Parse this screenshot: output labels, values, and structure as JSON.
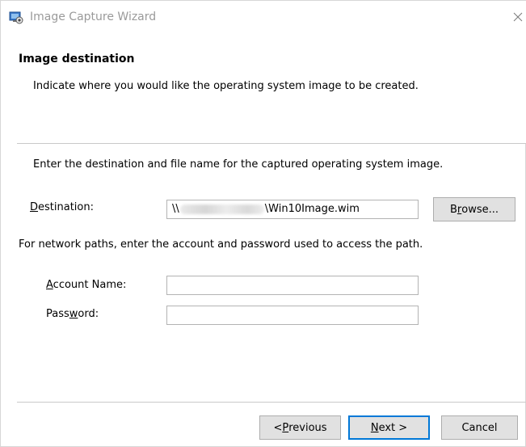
{
  "window": {
    "title": "Image Capture Wizard",
    "icon": "capture-wizard-icon",
    "close_icon": "close-icon"
  },
  "header": {
    "title": "Image destination",
    "description": "Indicate where you would like the operating system image to be created."
  },
  "body": {
    "instruction": "Enter the destination and file name for the captured operating system image.",
    "destination": {
      "label_access_key": "D",
      "label_rest": "estination:",
      "value_prefix": "\\\\",
      "value_suffix": "\\Win10Image.wim"
    },
    "browse": {
      "label_pre": "B",
      "label_access_key": "r",
      "label_post": "owse..."
    },
    "network_note": "For network paths, enter the account and password used to access the path.",
    "account_name": {
      "label_access_key": "A",
      "label_rest": "ccount Name:",
      "value": ""
    },
    "password": {
      "label_pre": "Pass",
      "label_access_key": "w",
      "label_post": "ord:",
      "value": ""
    }
  },
  "footer": {
    "previous": {
      "label_pre": "< ",
      "label_access_key": "P",
      "label_post": "revious"
    },
    "next": {
      "label_access_key": "N",
      "label_post": "ext >"
    },
    "cancel": "Cancel"
  },
  "colors": {
    "title_text": "#9a9a9a",
    "button_face": "#e1e1e1",
    "button_border": "#adadad",
    "default_button_border": "#0078d7",
    "divider": "#c9c9c9",
    "field_border": "#b3b3b3"
  }
}
